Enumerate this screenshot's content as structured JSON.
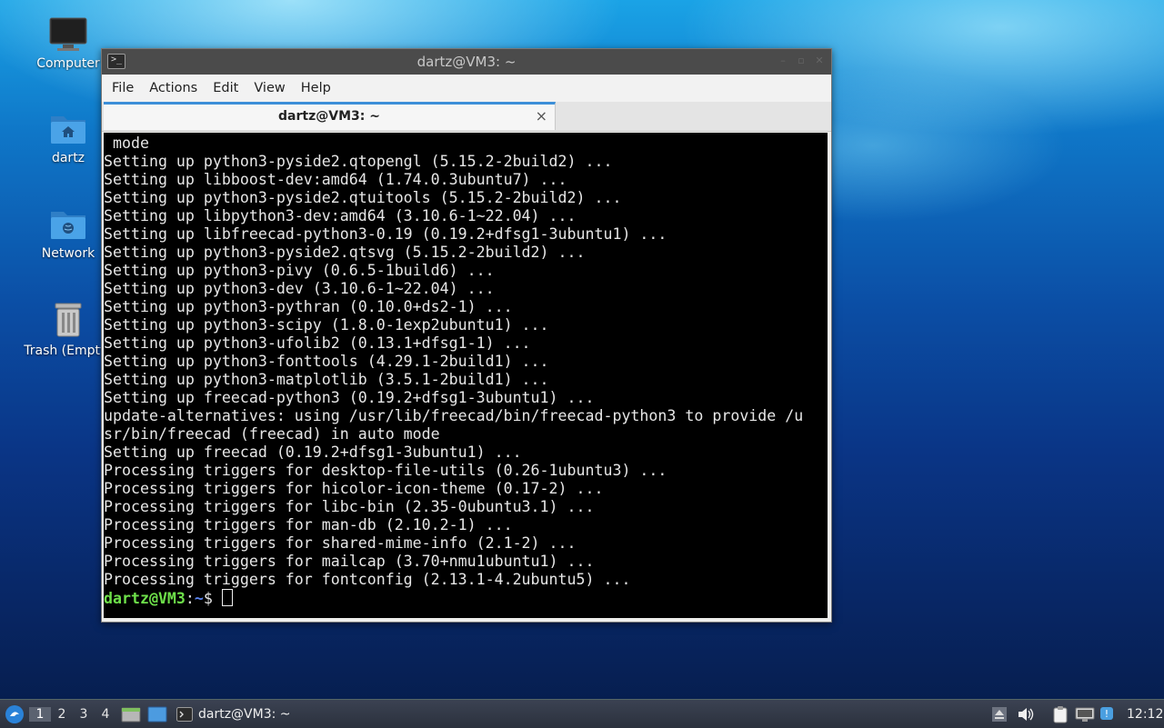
{
  "desktop": {
    "icons": [
      {
        "label": "Computer"
      },
      {
        "label": "dartz"
      },
      {
        "label": "Network"
      },
      {
        "label": "Trash (Empty)"
      }
    ]
  },
  "window": {
    "title": "dartz@VM3: ~",
    "menu": [
      "File",
      "Actions",
      "Edit",
      "View",
      "Help"
    ],
    "tab": {
      "title": "dartz@VM3: ~",
      "close": "×"
    }
  },
  "terminal": {
    "lines": [
      " mode",
      "Setting up python3-pyside2.qtopengl (5.15.2-2build2) ...",
      "Setting up libboost-dev:amd64 (1.74.0.3ubuntu7) ...",
      "Setting up python3-pyside2.qtuitools (5.15.2-2build2) ...",
      "Setting up libpython3-dev:amd64 (3.10.6-1~22.04) ...",
      "Setting up libfreecad-python3-0.19 (0.19.2+dfsg1-3ubuntu1) ...",
      "Setting up python3-pyside2.qtsvg (5.15.2-2build2) ...",
      "Setting up python3-pivy (0.6.5-1build6) ...",
      "Setting up python3-dev (3.10.6-1~22.04) ...",
      "Setting up python3-pythran (0.10.0+ds2-1) ...",
      "Setting up python3-scipy (1.8.0-1exp2ubuntu1) ...",
      "Setting up python3-ufolib2 (0.13.1+dfsg1-1) ...",
      "Setting up python3-fonttools (4.29.1-2build1) ...",
      "Setting up python3-matplotlib (3.5.1-2build1) ...",
      "Setting up freecad-python3 (0.19.2+dfsg1-3ubuntu1) ...",
      "update-alternatives: using /usr/lib/freecad/bin/freecad-python3 to provide /u",
      "sr/bin/freecad (freecad) in auto mode",
      "Setting up freecad (0.19.2+dfsg1-3ubuntu1) ...",
      "Processing triggers for desktop-file-utils (0.26-1ubuntu3) ...",
      "Processing triggers for hicolor-icon-theme (0.17-2) ...",
      "Processing triggers for libc-bin (2.35-0ubuntu3.1) ...",
      "Processing triggers for man-db (2.10.2-1) ...",
      "Processing triggers for shared-mime-info (2.1-2) ...",
      "Processing triggers for mailcap (3.70+nmu1ubuntu1) ...",
      "Processing triggers for fontconfig (2.13.1-4.2ubuntu5) ..."
    ],
    "prompt": {
      "user": "dartz@VM3",
      "sep": ":",
      "path": "~",
      "symbol": "$ "
    }
  },
  "taskbar": {
    "workspaces": [
      "1",
      "2",
      "3",
      "4"
    ],
    "task_label": "dartz@VM3: ~",
    "clock": "12:12"
  }
}
